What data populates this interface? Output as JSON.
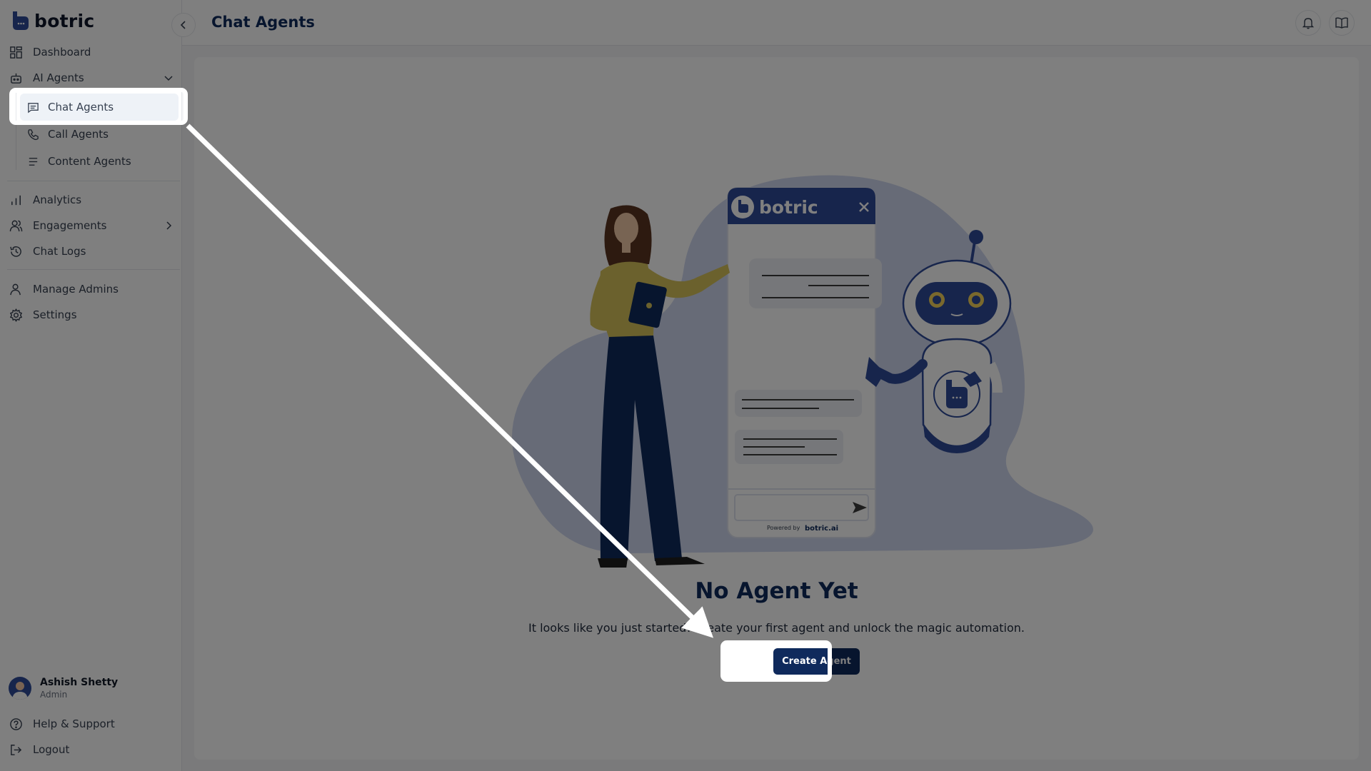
{
  "brand": {
    "name": "botric"
  },
  "sidebar": {
    "items": [
      {
        "label": "Dashboard"
      },
      {
        "label": "AI Agents"
      },
      {
        "label": "Analytics"
      },
      {
        "label": "Engagements"
      },
      {
        "label": "Chat Logs"
      },
      {
        "label": "Manage Admins"
      },
      {
        "label": "Settings"
      }
    ],
    "sub_items": [
      {
        "label": "Chat Agents",
        "active": true
      },
      {
        "label": "Call Agents"
      },
      {
        "label": "Content Agents"
      }
    ],
    "user": {
      "name": "Ashish Shetty",
      "role": "Admin"
    },
    "footer": [
      {
        "label": "Help & Support"
      },
      {
        "label": "Logout"
      }
    ]
  },
  "header": {
    "title": "Chat Agents"
  },
  "empty_state": {
    "title": "No Agent Yet",
    "description": "It looks like you just started! Create your first agent and unlock the magic automation.",
    "button_label": "Create Agent"
  },
  "illustration": {
    "widget_brand": "botric",
    "powered_by": "Powered by",
    "powered_brand": "botric.ai"
  },
  "colors": {
    "primary": "#0f2a5c",
    "accent": "#2f4a98",
    "blob": "#cfd6ee",
    "overlay": "rgba(0,0,0,0.5)"
  }
}
